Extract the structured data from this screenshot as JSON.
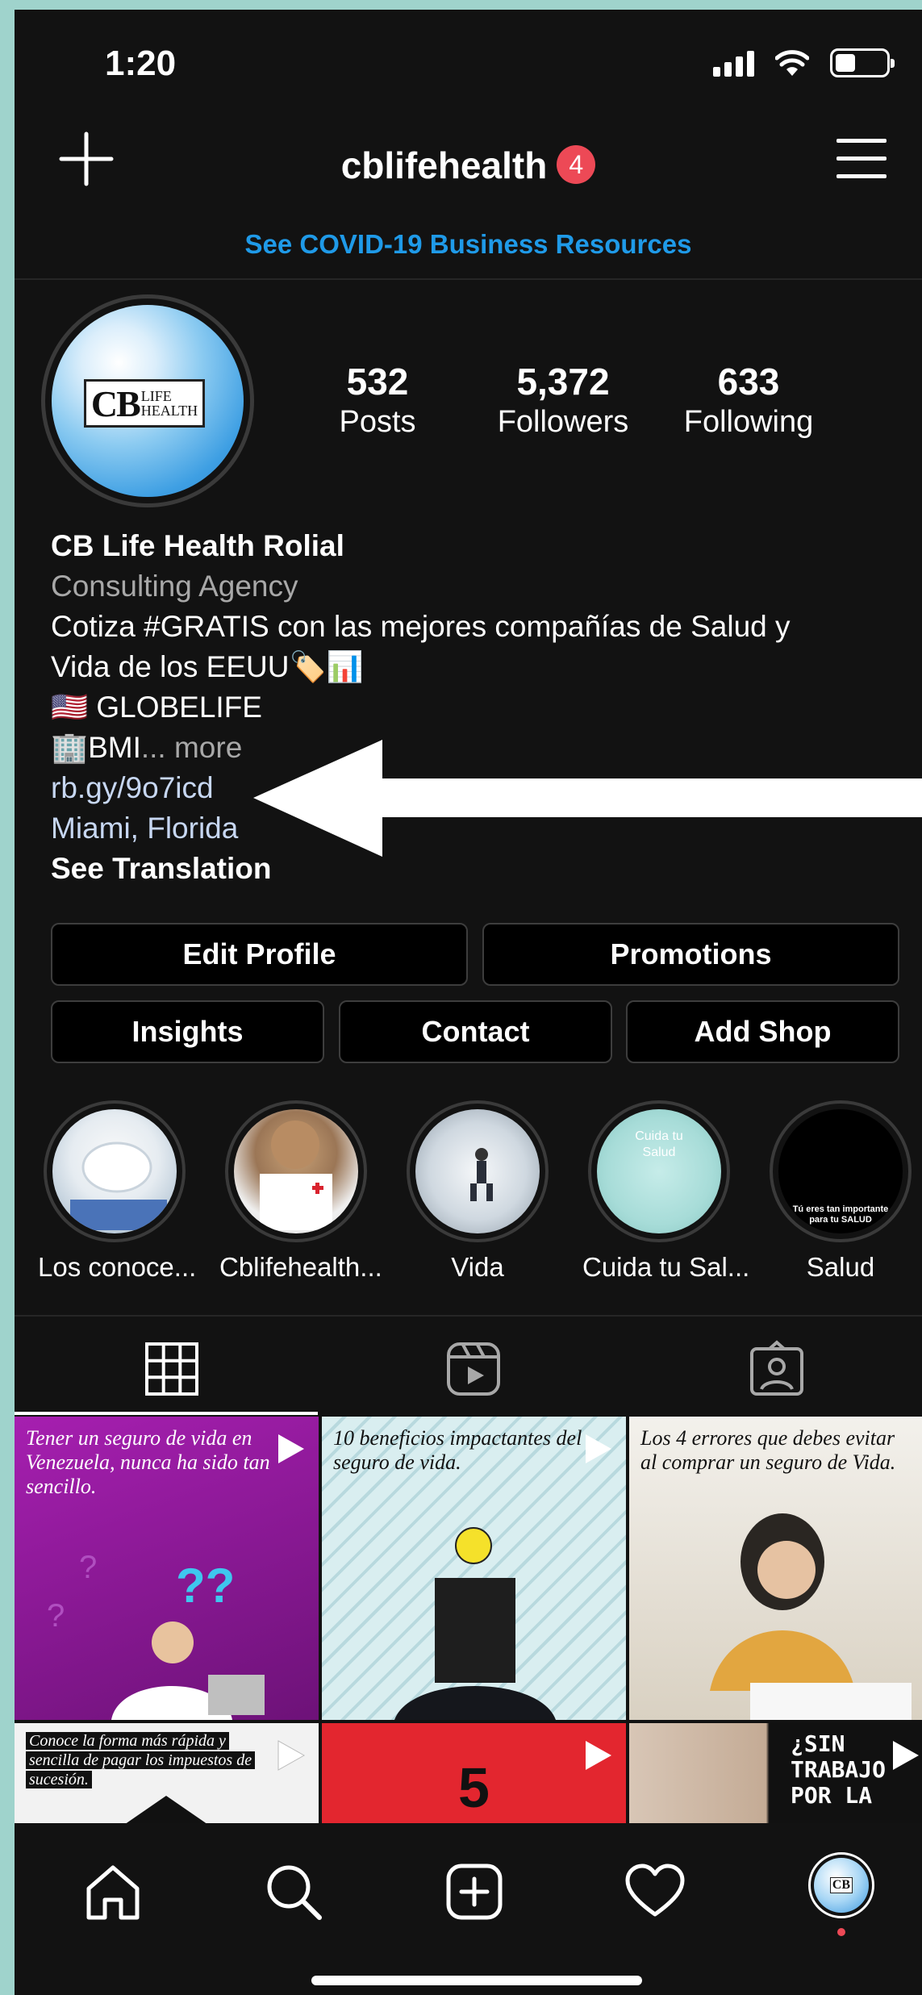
{
  "status_bar": {
    "time": "1:20"
  },
  "header": {
    "username": "cblifehealth",
    "notification_count": "4",
    "covid_link": "See COVID-19 Business Resources"
  },
  "profile": {
    "stats": [
      {
        "value": "532",
        "label": "Posts"
      },
      {
        "value": "5,372",
        "label": "Followers"
      },
      {
        "value": "633",
        "label": "Following"
      }
    ],
    "avatar_logo": {
      "cb": "CB",
      "life": "LIFE",
      "health": "HEALTH"
    },
    "name": "CB Life Health Rolial",
    "category": "Consulting Agency",
    "bio_line1": "Cotiza #GRATIS con las mejores compañías de Salud y",
    "bio_line2": "Vida de los EEUU🏷️📊",
    "bio_line3": "🇺🇸 GLOBELIFE",
    "bio_line4": "🏢BMI",
    "bio_more": "... more",
    "link": "rb.gy/9o7icd",
    "location": "Miami, Florida",
    "see_translation": "See Translation"
  },
  "buttons": {
    "edit_profile": "Edit Profile",
    "promotions": "Promotions",
    "insights": "Insights",
    "contact": "Contact",
    "add_shop": "Add Shop"
  },
  "highlights": [
    {
      "label": "Los conoce...",
      "overlay": ""
    },
    {
      "label": "Cblifehealth...",
      "overlay": ""
    },
    {
      "label": "Vida",
      "overlay": ""
    },
    {
      "label": "Cuida tu Sal...",
      "overlay": "Cuida tu Salud"
    },
    {
      "label": "Salud",
      "overlay": "Tú eres tan importante para tu SALUD"
    }
  ],
  "tabs": [
    {
      "icon": "grid-icon"
    },
    {
      "icon": "reels-icon"
    },
    {
      "icon": "tagged-icon"
    }
  ],
  "posts": [
    {
      "caption": "Tener un seguro de vida en Venezuela, nunca ha sido tan sencillo.",
      "background": "#8b1a96"
    },
    {
      "caption": "10 beneficios impactantes del seguro de vida.",
      "background": "#cfe6ea"
    },
    {
      "caption": "Los 4 errores que debes evitar al comprar un seguro de Vida.",
      "background": "#e8e3d8"
    },
    {
      "caption": "Conoce la forma más rápida y sencilla de pagar los impuestos de sucesión.",
      "background": "#f2f2f2"
    },
    {
      "caption": "5",
      "background": "#e3262f"
    },
    {
      "caption": "¿SIN TRABAJO POR LA",
      "background": "#1a1a1a"
    }
  ],
  "bottom_nav": [
    {
      "icon": "home-icon"
    },
    {
      "icon": "search-icon"
    },
    {
      "icon": "new-post-icon"
    },
    {
      "icon": "activity-heart-icon"
    },
    {
      "icon": "profile-avatar-icon"
    }
  ]
}
